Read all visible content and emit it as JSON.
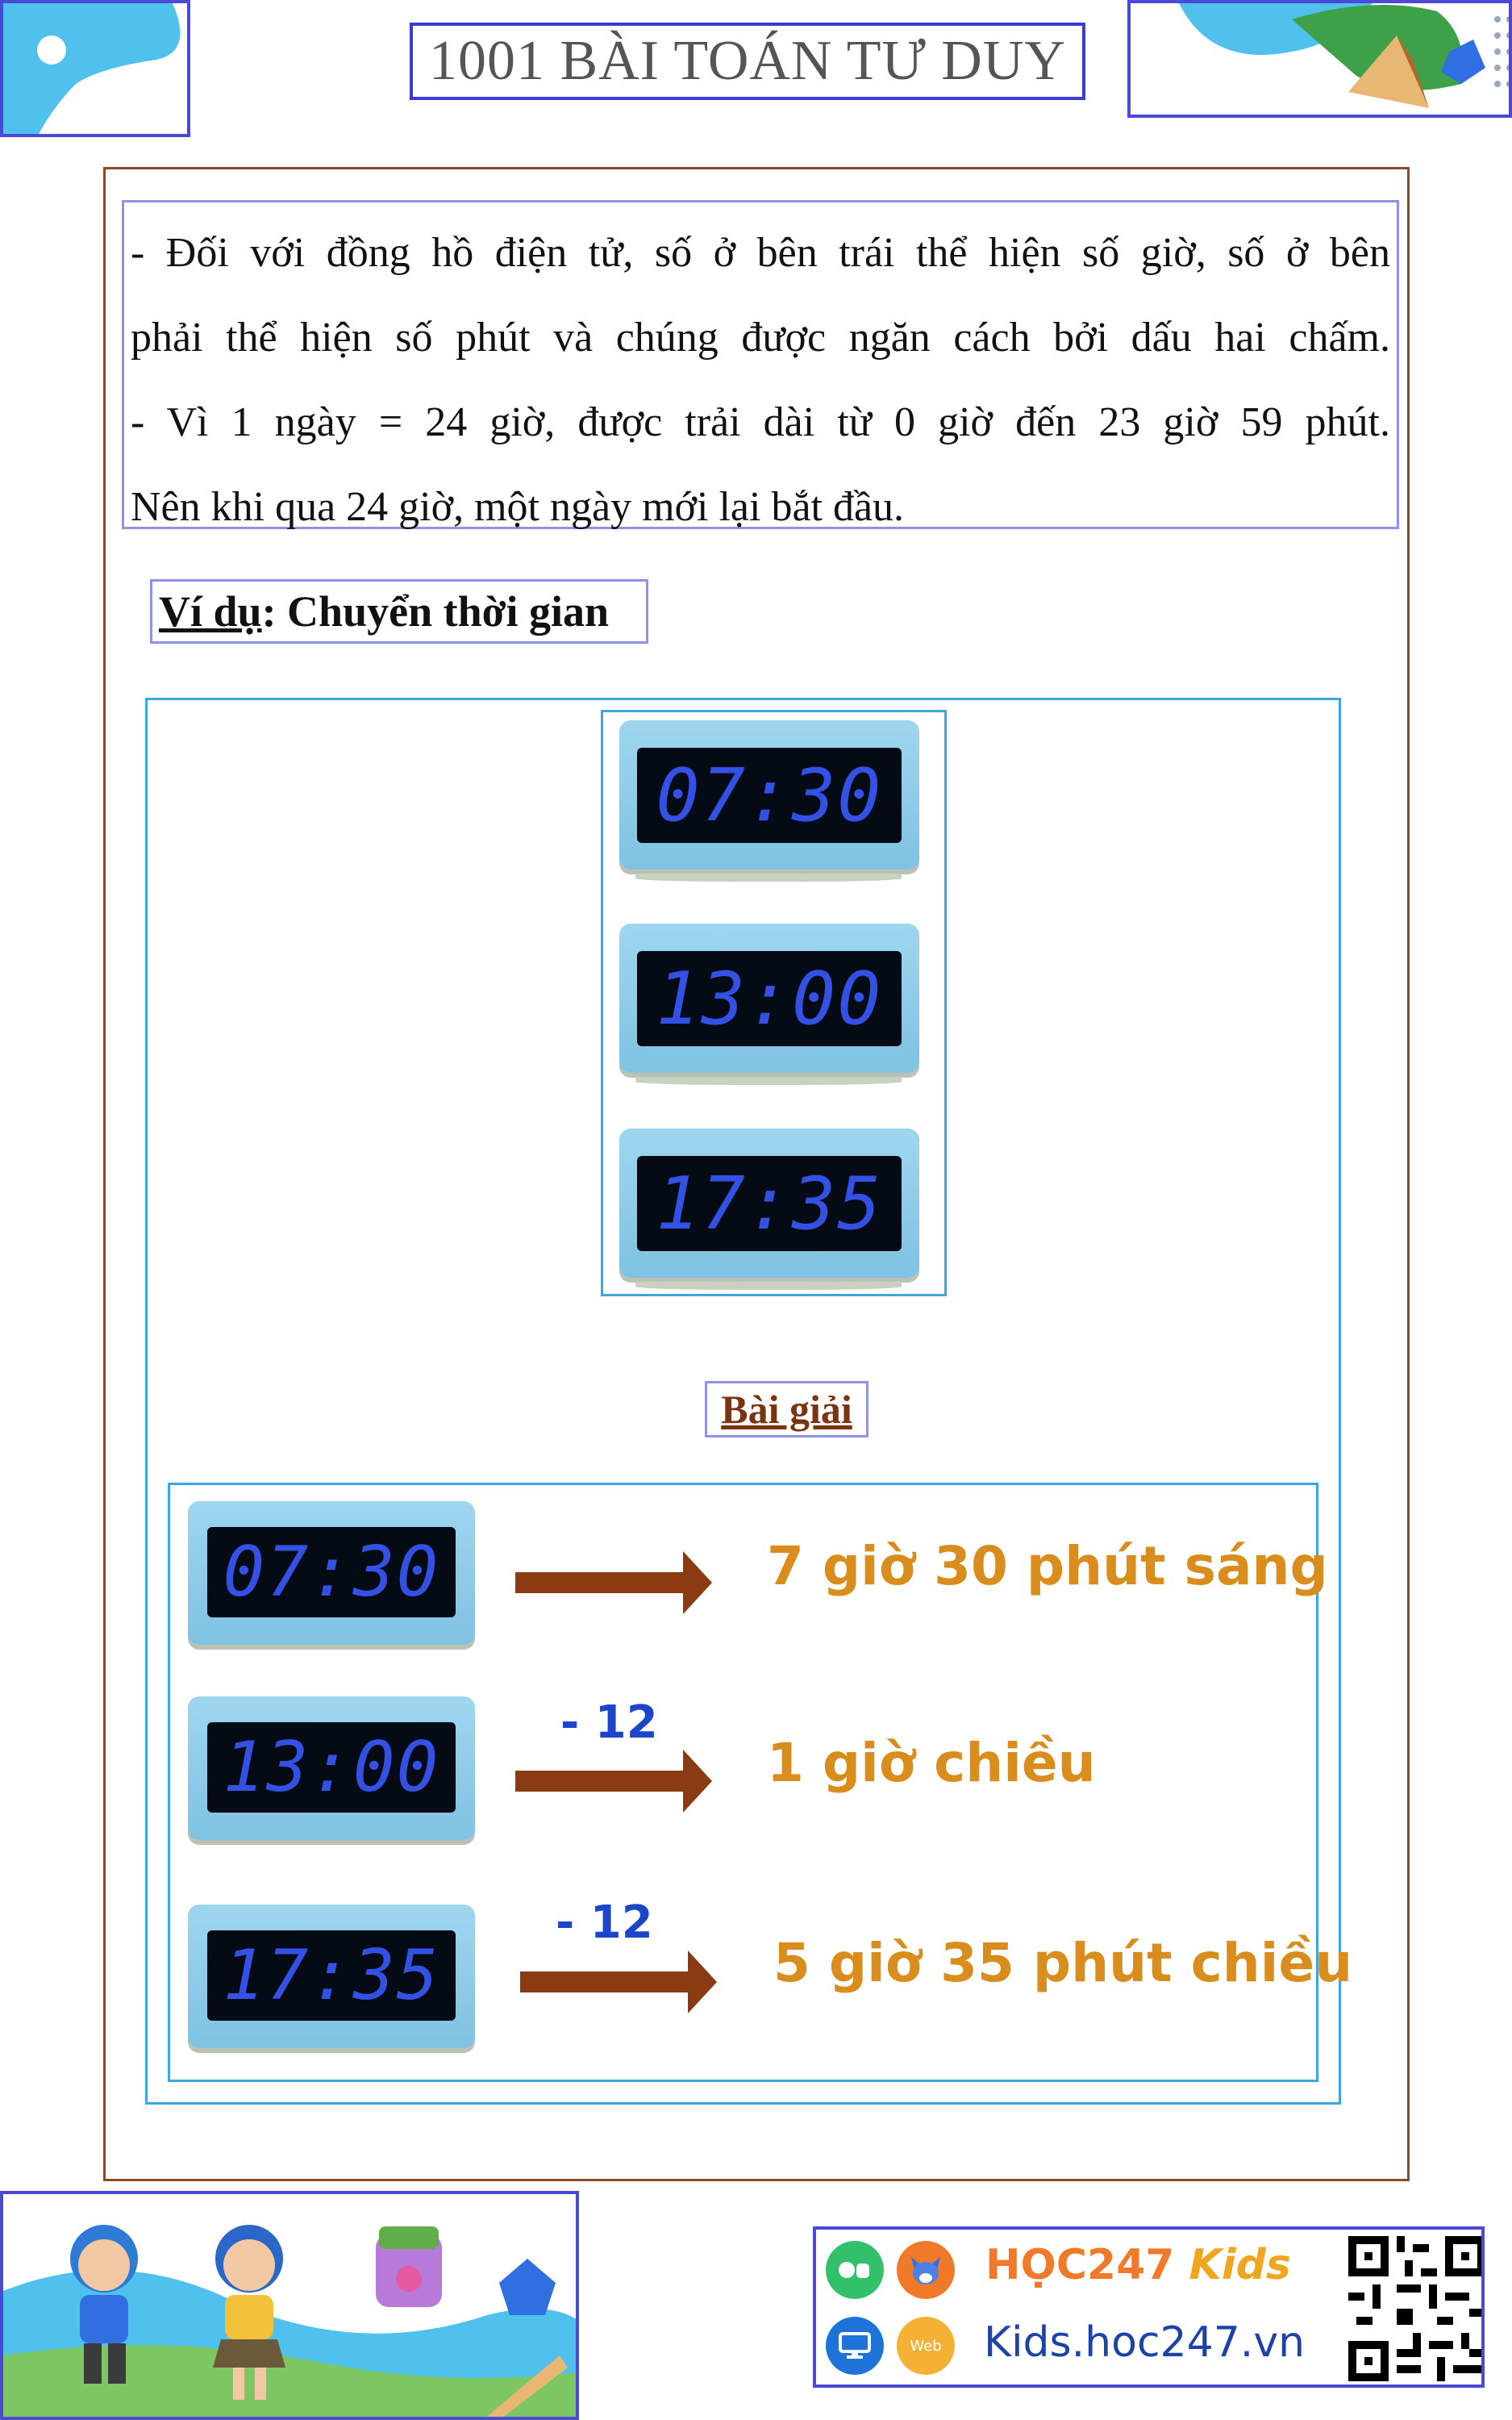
{
  "header": {
    "title": "1001 BÀI TOÁN TƯ DUY"
  },
  "intro": {
    "lines": [
      "- Đối với đồng hồ điện tử, số ở bên trái thể hiện số giờ, số ở bên",
      "phải thể hiện số phút và chúng được ngăn cách bởi dấu hai chấm.",
      "- Vì 1 ngày = 24 giờ, được trải dài từ 0 giờ đến 23 giờ 59 phút.",
      "Nên khi qua 24 giờ, một ngày mới lại bắt đầu."
    ]
  },
  "example": {
    "heading_prefix": "Ví dụ",
    "heading_rest": ": Chuyển thời gian"
  },
  "clocks": [
    "07:30",
    "13:00",
    "17:35"
  ],
  "solution": {
    "label": "Bài giải",
    "rows": [
      {
        "clock": "07:30",
        "operation": "",
        "result": "7 giờ 30 phút sáng"
      },
      {
        "clock": "13:00",
        "operation": "- 12",
        "result": "1 giờ chiều"
      },
      {
        "clock": "17:35",
        "operation": "- 12",
        "result": "5 giờ 35 phút chiều"
      }
    ]
  },
  "footer": {
    "brand_left": "HỌC247",
    "brand_right": "Kids",
    "url": "Kids.hoc247.vn",
    "web_badge": "Web"
  },
  "colors": {
    "accent_border": "#4b49d6",
    "frame": "#8b4a2b",
    "clock_digits": "#3451e6",
    "result_text": "#d88d1c",
    "arrow": "#8a3b12"
  },
  "icons": [
    "app-store-icon",
    "android-icon",
    "fox-mascot-icon",
    "monitor-icon",
    "qr-code-icon"
  ]
}
